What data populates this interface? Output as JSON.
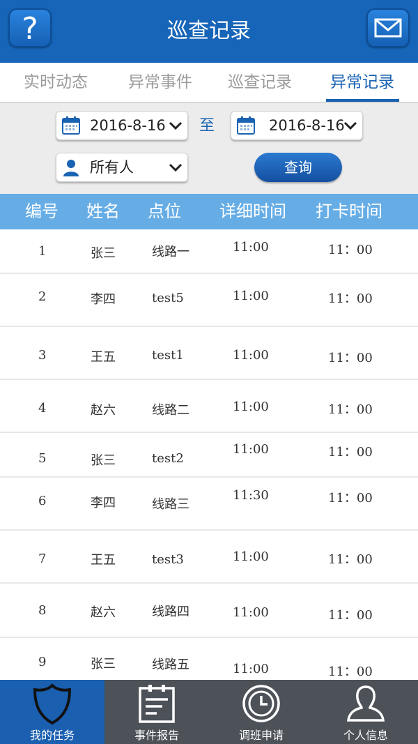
{
  "header": {
    "title": "巡查记录"
  },
  "tabs": [
    {
      "label": "实时动态",
      "active": false
    },
    {
      "label": "异常事件",
      "active": false
    },
    {
      "label": "巡查记录",
      "active": false
    },
    {
      "label": "异常记录",
      "active": true
    }
  ],
  "filter": {
    "start_date": "2016-8-16",
    "to_label": "至",
    "end_date": "2016-8-16",
    "person": "所有人",
    "query_label": "查询"
  },
  "table": {
    "columns": [
      "编号",
      "姓名",
      "点位",
      "详细时间",
      "打卡时间"
    ],
    "rows": [
      {
        "id": "1",
        "name": "张三",
        "point": "线路一",
        "detail_time": "11:00",
        "clock_time": "11：00"
      },
      {
        "id": "2",
        "name": "李四",
        "point": "test5",
        "detail_time": "11:00",
        "clock_time": "11：00"
      },
      {
        "id": "3",
        "name": "王五",
        "point": "test1",
        "detail_time": "11:00",
        "clock_time": "11：00"
      },
      {
        "id": "4",
        "name": "赵六",
        "point": "线路二",
        "detail_time": "11:00",
        "clock_time": "11：00"
      },
      {
        "id": "5",
        "name": "张三",
        "point": "test2",
        "detail_time": "11:00",
        "clock_time": "11：00"
      },
      {
        "id": "6",
        "name": "李四",
        "point": "线路三",
        "detail_time": "11:30",
        "clock_time": "11：00"
      },
      {
        "id": "7",
        "name": "王五",
        "point": "test3",
        "detail_time": "11:00",
        "clock_time": "11：00"
      },
      {
        "id": "8",
        "name": "赵六",
        "point": "线路四",
        "detail_time": "11:00",
        "clock_time": "11：00"
      },
      {
        "id": "9",
        "name": "张三",
        "point": "线路五",
        "detail_time": "11:00",
        "clock_time": "11：00"
      }
    ]
  },
  "bottom_nav": [
    {
      "label": "我的任务",
      "icon": "shield-icon",
      "active": true
    },
    {
      "label": "事件报告",
      "icon": "clipboard-icon",
      "active": false
    },
    {
      "label": "调班申请",
      "icon": "clock-icon",
      "active": false
    },
    {
      "label": "个人信息",
      "icon": "person-icon",
      "active": false
    }
  ],
  "colors": {
    "primary": "#1765b8",
    "table_header": "#66ade6",
    "nav_bg": "#4d5158"
  }
}
